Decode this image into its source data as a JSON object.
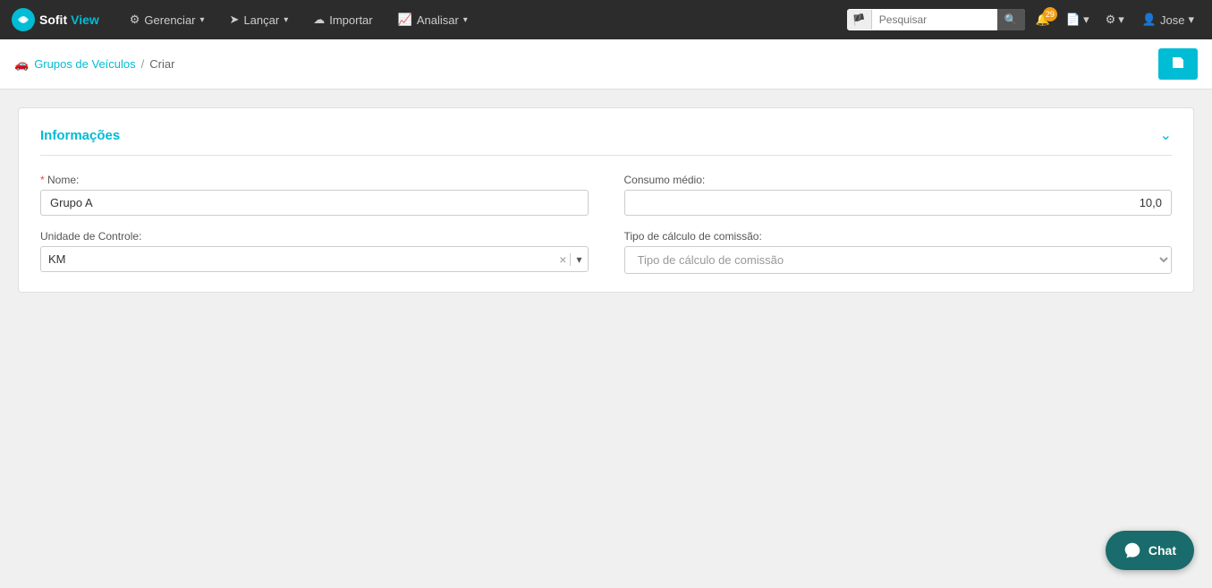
{
  "brand": {
    "sofit": "Sofit",
    "view": "View"
  },
  "navbar": {
    "items": [
      {
        "id": "gerenciar",
        "label": "Gerenciar",
        "hasDropdown": true,
        "icon": "gear"
      },
      {
        "id": "lancar",
        "label": "Lançar",
        "hasDropdown": true,
        "icon": "arrow"
      },
      {
        "id": "importar",
        "label": "Importar",
        "hasDropdown": false,
        "icon": "cloud"
      },
      {
        "id": "analisar",
        "label": "Analisar",
        "hasDropdown": true,
        "icon": "chart"
      }
    ],
    "search_placeholder": "Pesquisar",
    "badge_count": "29",
    "user": "Jose"
  },
  "breadcrumb": {
    "link_label": "Grupos de Veículos",
    "separator": "/",
    "current": "Criar"
  },
  "save_button": "💾",
  "section": {
    "title": "Informações",
    "fields": {
      "nome_label": "* Nome:",
      "nome_required": "*",
      "nome_label_text": "Nome:",
      "nome_value": "Grupo A",
      "nome_placeholder": "",
      "consumo_label": "Consumo médio:",
      "consumo_value": "10,0",
      "unidade_label": "Unidade de Controle:",
      "unidade_value": "KM",
      "tipo_label": "Tipo de cálculo de comissão:",
      "tipo_placeholder": "Tipo de cálculo de comissão"
    }
  },
  "chat": {
    "label": "Chat"
  }
}
